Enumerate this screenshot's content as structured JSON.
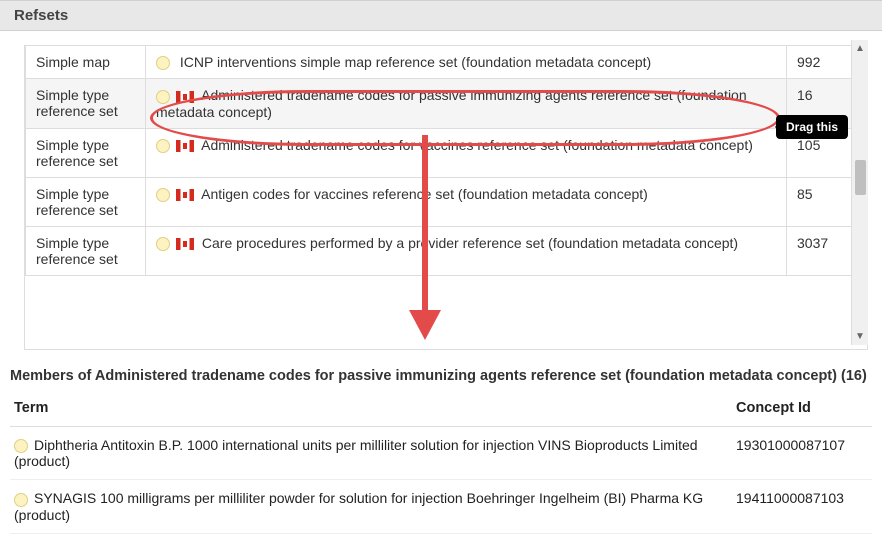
{
  "refsets_header": "Refsets",
  "icons": {
    "concept_dot": "concept-dot",
    "canada_flag": "canada-flag"
  },
  "tooltip": {
    "drag_this": "Drag this"
  },
  "refsets": {
    "rows": [
      {
        "type": "Simple map",
        "flag": false,
        "name": "ICNP interventions simple map reference set (foundation metadata concept)",
        "count": "992"
      },
      {
        "type": "Simple type reference set",
        "flag": true,
        "name": "Administered tradename codes for passive immunizing agents reference set (foundation metadata concept)",
        "count": "16",
        "highlight": true
      },
      {
        "type": "Simple type reference set",
        "flag": true,
        "name": "Administered tradename codes for vaccines reference set (foundation metadata concept)",
        "count": "105"
      },
      {
        "type": "Simple type reference set",
        "flag": true,
        "name": "Antigen codes for vaccines reference set (foundation metadata concept)",
        "count": "85"
      },
      {
        "type": "Simple type reference set",
        "flag": true,
        "name": "Care procedures performed by a provider reference set (foundation metadata concept)",
        "count": "3037"
      }
    ]
  },
  "members": {
    "title": "Members of Administered tradename codes for passive immunizing agents reference set (foundation metadata concept) (16)",
    "columns": {
      "term": "Term",
      "concept_id": "Concept Id"
    },
    "rows": [
      {
        "term": "Diphtheria Antitoxin B.P. 1000 international units per milliliter solution for injection VINS Bioproducts Limited (product)",
        "concept_id": "19301000087107"
      },
      {
        "term": "SYNAGIS 100 milligrams per milliliter powder for solution for injection Boehringer Ingelheim (BI) Pharma KG (product)",
        "concept_id": "19411000087103"
      }
    ]
  }
}
